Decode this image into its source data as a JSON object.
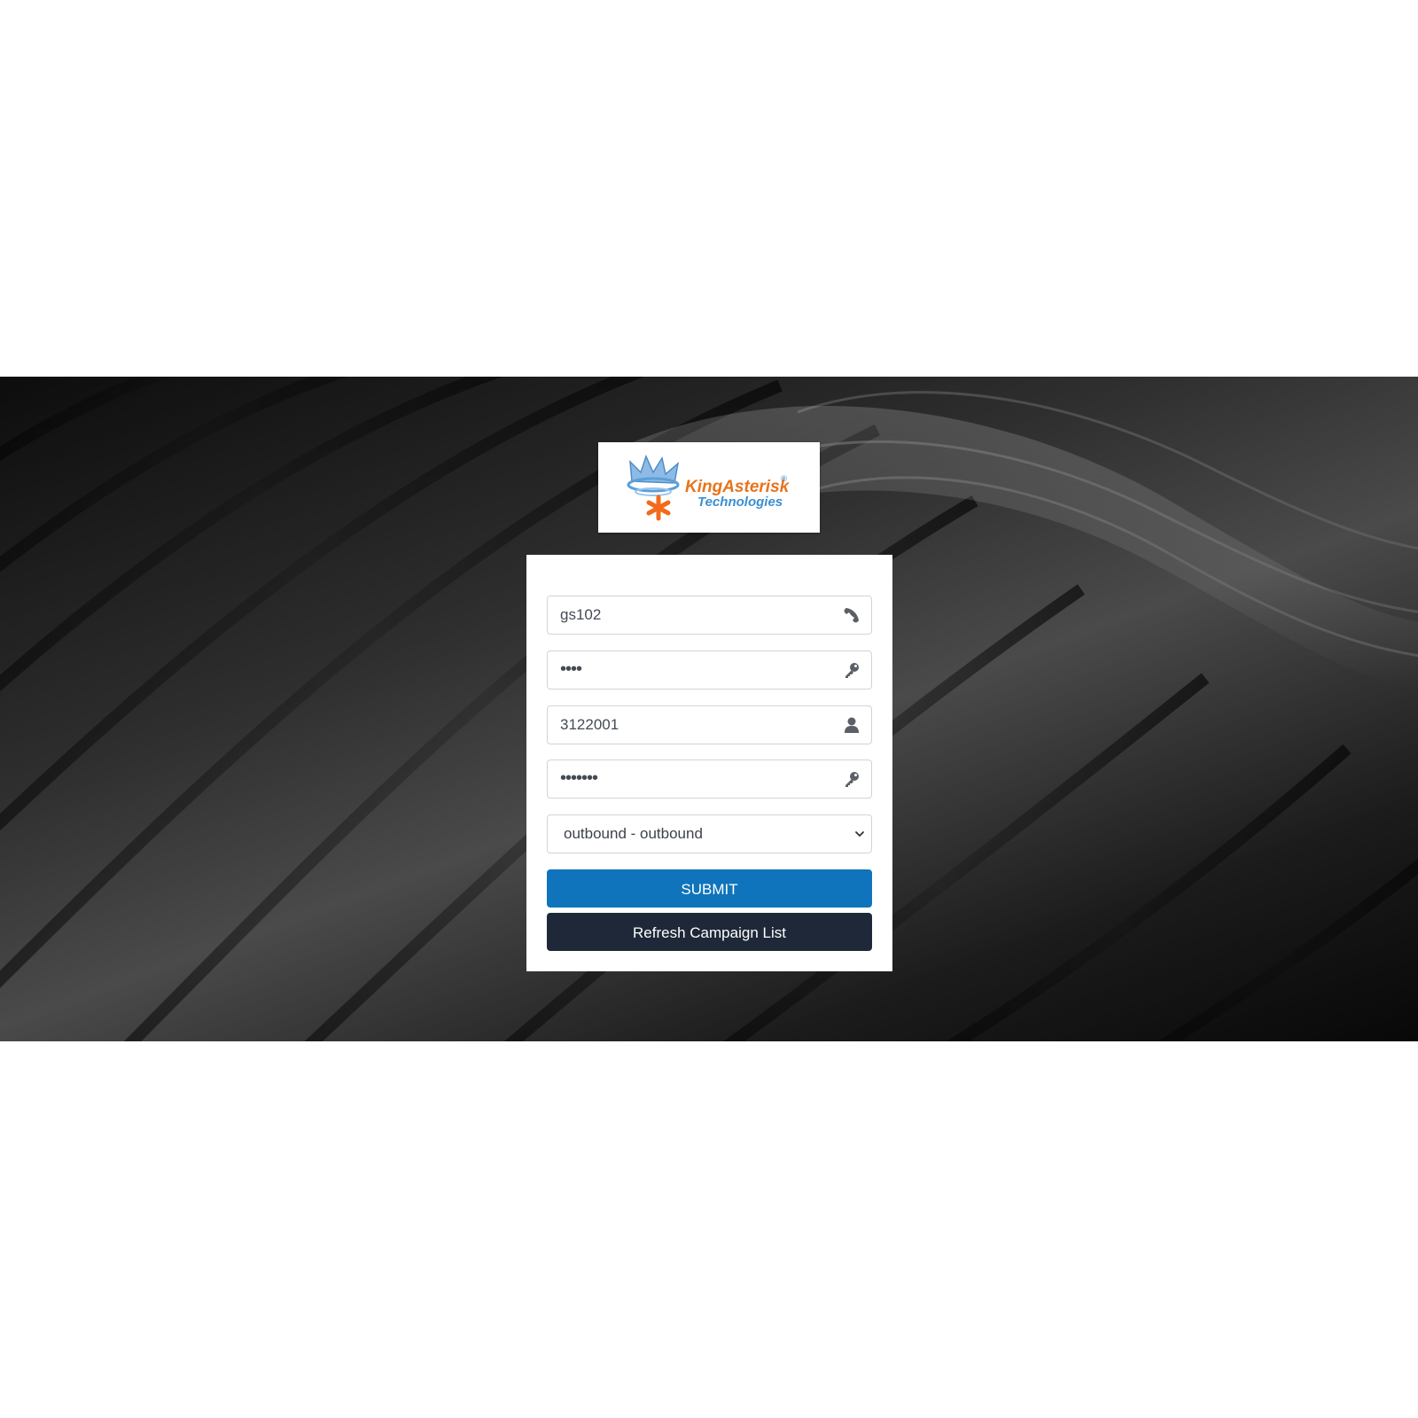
{
  "logo": {
    "brand_line1": "KingAsterisk",
    "brand_line2": "Technologies",
    "registered_mark": "®",
    "colors": {
      "crown_blue": "#6fa8dc",
      "asterisk_orange": "#f26a1b",
      "text_orange": "#e8731c",
      "text_blue": "#3b8fd1"
    }
  },
  "form": {
    "phone_login": {
      "value": "gs102",
      "icon": "phone-icon"
    },
    "phone_password": {
      "value": "••••",
      "icon": "key-icon"
    },
    "user_login": {
      "value": "3122001",
      "icon": "user-icon"
    },
    "user_password": {
      "value": "•••••••",
      "icon": "key-icon"
    },
    "campaign_select": {
      "selected": "outbound - outbound",
      "icon": "chevron-down-icon"
    },
    "submit_label": "SUBMIT",
    "refresh_label": "Refresh Campaign List"
  },
  "colors": {
    "submit_bg": "#0f74bb",
    "refresh_bg": "#1e2838",
    "field_border": "#cfd4da"
  }
}
